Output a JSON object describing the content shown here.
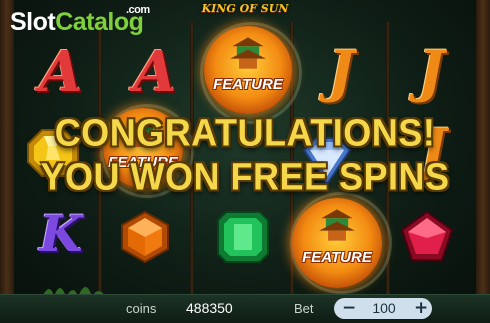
{
  "watermark": {
    "brand_slot": "Slot",
    "brand_catalog": "Catalog",
    "brand_com": ".com"
  },
  "game": {
    "title": "KING OF SUN"
  },
  "banner": {
    "line1": "CONGRATULATIONS!",
    "line2": "YOU WON FREE SPINS"
  },
  "symbols": {
    "letter_a": "A",
    "letter_j": "J",
    "letter_k": "K",
    "feature_label": "FEATURE"
  },
  "bottom_bar": {
    "coins_label": "coins",
    "coins_value": "488350",
    "bet_label": "Bet",
    "bet_value": "100",
    "minus_label": "−",
    "plus_label": "+"
  },
  "colors": {
    "banner_text": "#f5d84a",
    "brand_green": "#7fd13b",
    "letter_a": "#e23a3a",
    "letter_k": "#7b48e0",
    "letter_j": "#f08a16",
    "gem_yellow": "#f5c518",
    "gem_orange": "#f07a10",
    "gem_green": "#22c35a",
    "gem_red": "#e0204a",
    "gem_blue": "#9ec4ff"
  },
  "icons": [
    "pagoda-icon",
    "minus-icon",
    "plus-icon"
  ]
}
